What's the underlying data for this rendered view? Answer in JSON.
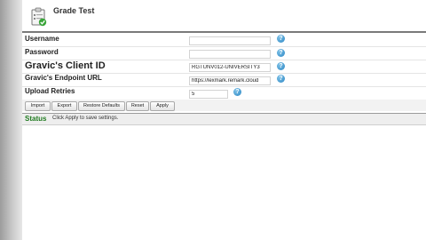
{
  "header": {
    "title": "Grade Test",
    "icon": "clipboard-check-icon"
  },
  "fields": {
    "username": {
      "label": "Username",
      "value": ""
    },
    "password": {
      "label": "Password",
      "value": ""
    },
    "client_id": {
      "label": "Gravic's Client ID",
      "value": "RGTUNV012-UNIVERSITY3"
    },
    "endpoint": {
      "label": "Gravic's Endpoint URL",
      "value": "https://lexmark.remark.cloud"
    },
    "retries": {
      "label": "Upload Retries",
      "value": "5"
    }
  },
  "help": {
    "glyph": "?",
    "color": "#2b86c3"
  },
  "buttons": {
    "import": "Import",
    "export": "Export",
    "restore": "Restore Defaults",
    "reset": "Reset",
    "apply": "Apply"
  },
  "status": {
    "label": "Status",
    "message": "Click Apply to save settings.",
    "color": "#1f7a1f"
  }
}
